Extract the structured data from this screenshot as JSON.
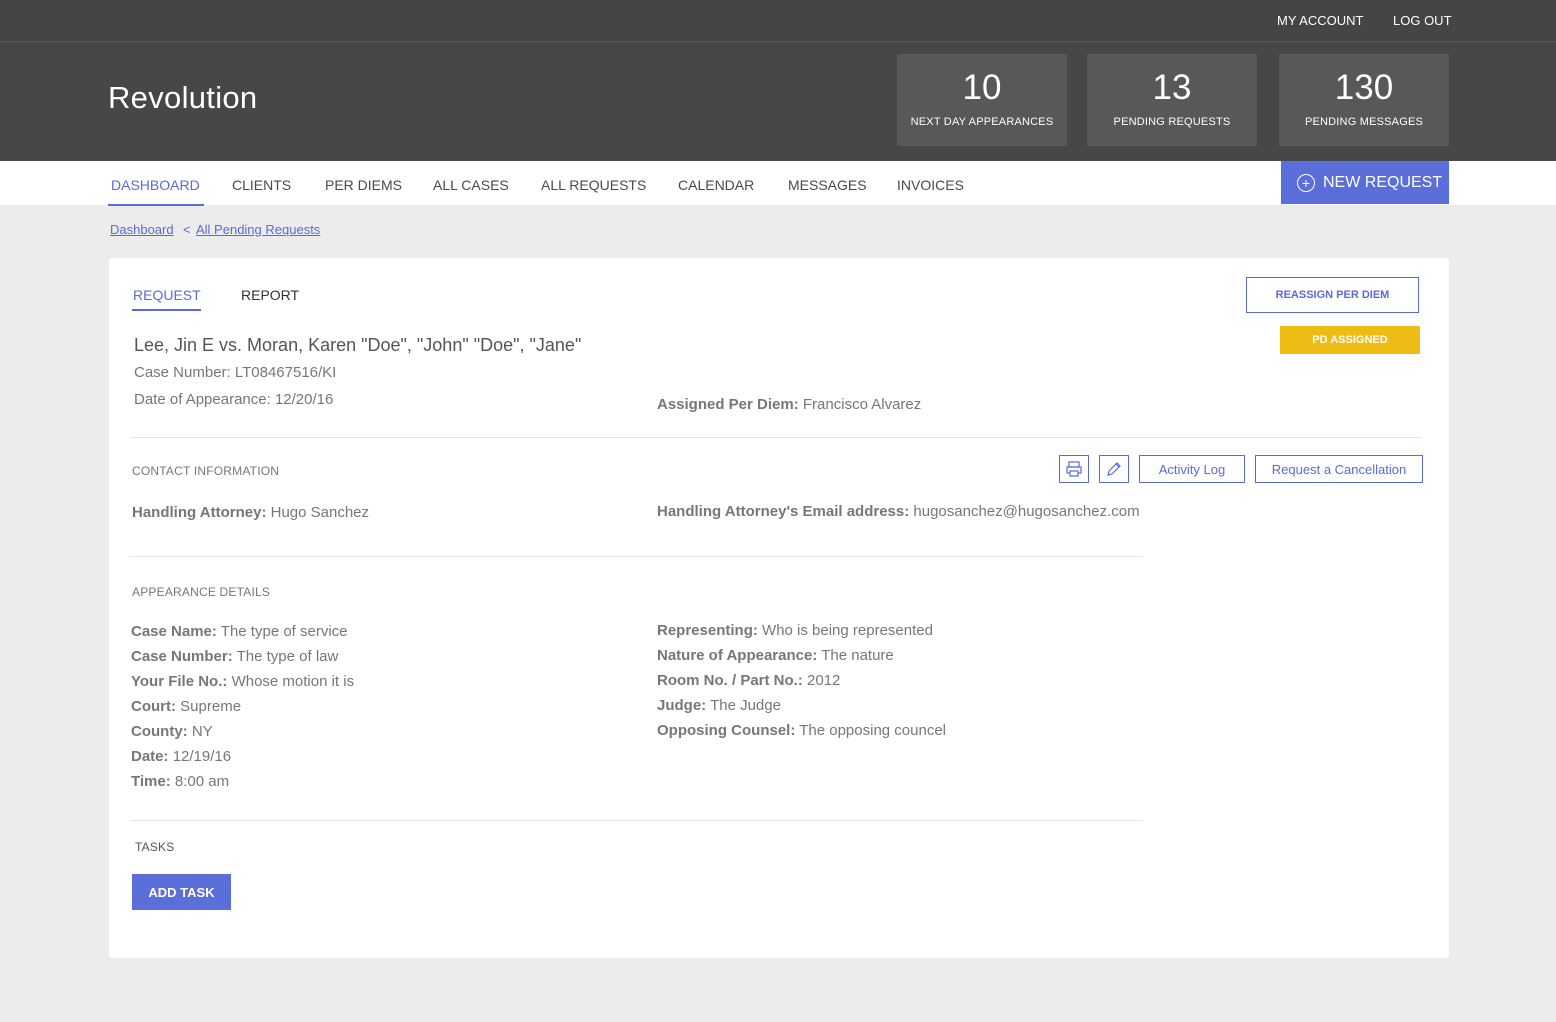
{
  "topbar": {
    "my_account": "MY ACCOUNT",
    "log_out": "LOG OUT"
  },
  "header": {
    "brand": "Revolution",
    "stats": [
      {
        "value": "10",
        "label": "NEXT DAY APPEARANCES"
      },
      {
        "value": "13",
        "label": "PENDING REQUESTS"
      },
      {
        "value": "130",
        "label": "PENDING MESSAGES"
      }
    ]
  },
  "nav": {
    "items": [
      "DASHBOARD",
      "CLIENTS",
      "PER DIEMS",
      "ALL CASES",
      "ALL REQUESTS",
      "CALENDAR",
      "MESSAGES",
      "INVOICES"
    ],
    "active": "DASHBOARD",
    "new_request": "NEW REQUEST"
  },
  "breadcrumb": {
    "items": [
      "Dashboard",
      "All Pending Requests"
    ],
    "separator": "<"
  },
  "card": {
    "tabs": [
      "REQUEST",
      "REPORT"
    ],
    "reassign_button": "REASSIGN PER DIEM",
    "status_badge": "PD ASSIGNED",
    "status_color": "#eebc14",
    "case_title": "Lee, Jin E vs. Moran, Karen \"Doe\", \"John\" \"Doe\", \"Jane\"",
    "case_number": {
      "label": "Case Number:",
      "value": "LT08467516/KI"
    },
    "date_of_appearance": {
      "label": "Date of Appearance:",
      "value": "12/20/16"
    },
    "assigned_per_diem": {
      "label": "Assigned Per Diem:",
      "value": "Francisco Alvarez"
    },
    "contact": {
      "heading": "CONTACT INFORMATION",
      "handling_attorney": {
        "label": "Handling Attorney:",
        "value": "Hugo Sanchez"
      },
      "email": {
        "label": "Handling Attorney's Email address:",
        "value": "hugosanchez@hugosanchez.com"
      },
      "activity_log": "Activity Log",
      "cancel": "Request a Cancellation"
    },
    "appearance": {
      "heading": "APPEARANCE DETAILS",
      "left": [
        {
          "label": "Case Name:",
          "value": "The type of service"
        },
        {
          "label": "Case Number:",
          "value": "The type of law"
        },
        {
          "label": "Your File No.:",
          "value": "Whose motion it is"
        },
        {
          "label": "Court:",
          "value": "Supreme"
        },
        {
          "label": "County:",
          "value": "NY"
        },
        {
          "label": "Date:",
          "value": "12/19/16"
        },
        {
          "label": "Time:",
          "value": "8:00 am"
        }
      ],
      "right": [
        {
          "label": "Representing:",
          "value": "Who is being represented"
        },
        {
          "label": "Nature of Appearance:",
          "value": "The nature"
        },
        {
          "label": "Room No. / Part No.:",
          "value": "2012"
        },
        {
          "label": "Judge:",
          "value": "The Judge"
        },
        {
          "label": "Opposing Counsel:",
          "value": "The opposing councel"
        }
      ]
    },
    "tasks": {
      "heading": "TASKS",
      "add_task": "ADD TASK"
    }
  },
  "colors": {
    "accent": "#5b6fdb",
    "header_bg": "#474747",
    "badge": "#eebc14"
  }
}
